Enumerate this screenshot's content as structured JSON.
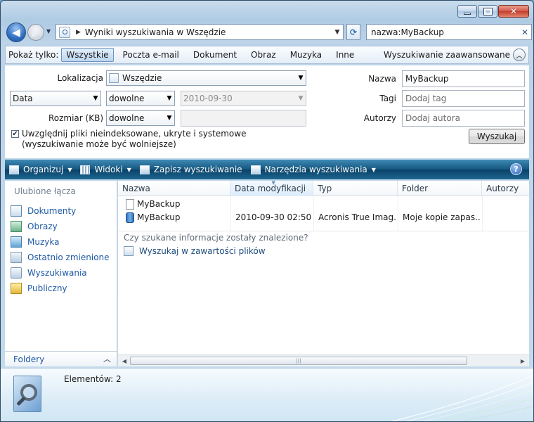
{
  "window": {
    "caption_buttons": [
      "minimize",
      "maximize",
      "close"
    ],
    "close_glyph": "✕"
  },
  "nav": {
    "back_glyph": "◀",
    "forward_glyph": "▶",
    "history_dropdown_glyph": "▼"
  },
  "address": {
    "text": "Wyniki wyszukiwania w Wszędzie",
    "separator": "▶",
    "dropdown_glyph": "▼"
  },
  "refresh_glyph": "⟳",
  "search": {
    "value": "nazwa:MyBackup",
    "clear_glyph": "✕"
  },
  "filter": {
    "label": "Pokaż tylko:",
    "buttons": [
      "Wszystkie",
      "Poczta e-mail",
      "Dokument",
      "Obraz",
      "Muzyka",
      "Inne"
    ],
    "active_index": 0,
    "advanced": "Wyszukiwanie zaawansowane",
    "advanced_toggle_glyph": "︿"
  },
  "advanced": {
    "location_label": "Lokalizacja",
    "location_value": "Wszędzie",
    "date_field": "Data",
    "date_qualifier": "dowolne",
    "date_value": "2010-09-30",
    "size_label": "Rozmiar (KB)",
    "size_qualifier": "dowolne",
    "size_value": "",
    "include_checked": true,
    "checkmark_glyph": "✔",
    "include_label": "Uwzględnij pliki nieindeksowane, ukryte i systemowe (wyszukiwanie może być wolniejsze)",
    "name_label": "Nazwa",
    "name_value": "MyBackup",
    "tags_label": "Tagi",
    "tags_placeholder": "Dodaj tag",
    "authors_label": "Autorzy",
    "authors_placeholder": "Dodaj autora",
    "search_button": "Wyszukaj",
    "dropdown_glyph": "▼"
  },
  "toolbar": {
    "organize": "Organizuj",
    "views": "Widoki",
    "save_search": "Zapisz wyszukiwanie",
    "search_tools": "Narzędzia wyszukiwania",
    "dropdown_glyph": "▼",
    "help_glyph": "?"
  },
  "navpane": {
    "title": "Ulubione łącza",
    "links": [
      {
        "label": "Dokumenty",
        "icon": "documents-icon"
      },
      {
        "label": "Obrazy",
        "icon": "pictures-icon"
      },
      {
        "label": "Muzyka",
        "icon": "music-icon"
      },
      {
        "label": "Ostatnio zmienione",
        "icon": "recent-icon"
      },
      {
        "label": "Wyszukiwania",
        "icon": "searches-icon"
      },
      {
        "label": "Publiczny",
        "icon": "public-folder-icon"
      }
    ],
    "folders": "Foldery",
    "folders_chevron": "︿"
  },
  "list": {
    "columns": [
      "Nazwa",
      "Data modyfikacji",
      "Typ",
      "Folder",
      "Autorzy"
    ],
    "sorted_column": 1,
    "sort_glyph": "▼",
    "rows": [
      {
        "name": "MyBackup",
        "icon": "document-icon",
        "date": "",
        "type": "",
        "folder": "",
        "authors": ""
      },
      {
        "name": "MyBackup",
        "icon": "backup-archive-icon",
        "date": "2010-09-30 02:50",
        "type": "Acronis True Imag...",
        "folder": "Moje kopie zapas...",
        "authors": ""
      }
    ],
    "not_found_question": "Czy szukane informacje zostały znalezione?",
    "search_contents": "Wyszukaj w zawartości plików",
    "scroll_left_glyph": "◀",
    "scroll_right_glyph": "▶",
    "scroll_grip": "|||"
  },
  "details": {
    "count_text": "Elementów: 2"
  }
}
